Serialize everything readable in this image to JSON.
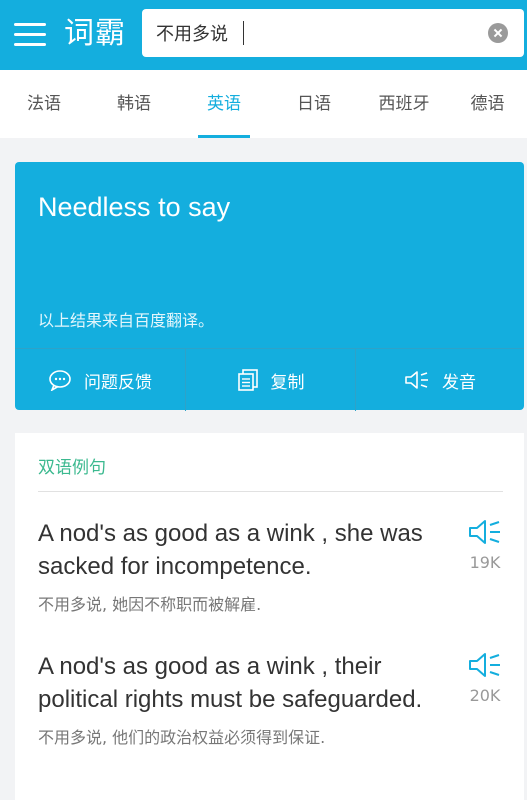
{
  "header": {
    "logo": "词霸",
    "search_value": "不用多说",
    "search_placeholder": ""
  },
  "tabs": [
    {
      "label": "法语",
      "active": false
    },
    {
      "label": "韩语",
      "active": false
    },
    {
      "label": "英语",
      "active": true
    },
    {
      "label": "日语",
      "active": false
    },
    {
      "label": "西班牙",
      "active": false
    },
    {
      "label": "德语",
      "active": false
    }
  ],
  "result": {
    "translation": "Needless to say",
    "source": "以上结果来自百度翻译。",
    "actions": {
      "feedback": "问题反馈",
      "copy": "复制",
      "pronounce": "发音"
    }
  },
  "examples": {
    "title": "双语例句",
    "items": [
      {
        "en": "A nod's as good as a wink , she was sacked for incompetence.",
        "zh": "不用多说, 她因不称职而被解雇.",
        "count": "19K"
      },
      {
        "en": "A nod's as good as a wink , their political rights must be safeguarded.",
        "zh": "不用多说, 他们的政治权益必须得到保证.",
        "count": "20K"
      }
    ]
  },
  "colors": {
    "accent": "#14aede",
    "section_title": "#3bb98f"
  }
}
